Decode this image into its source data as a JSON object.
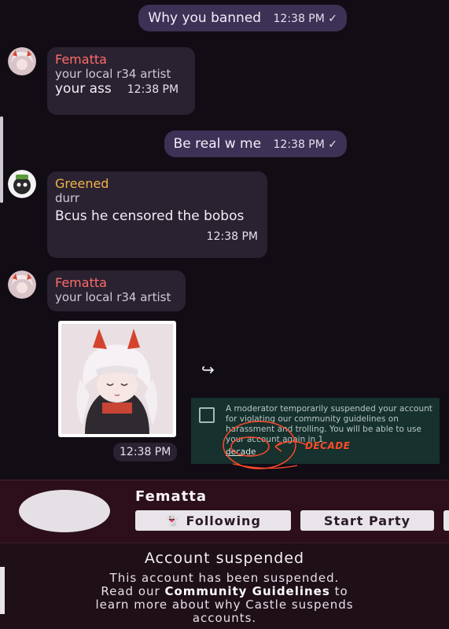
{
  "messages": [
    {
      "type": "out",
      "text": "Why you banned",
      "time": "12:38 PM ✓"
    },
    {
      "type": "in",
      "sender": "Fematta",
      "sender_color": "#ff6b6b",
      "subtitle": "your local r34 artist",
      "text": "your ass",
      "time": "12:38 PM"
    },
    {
      "type": "out",
      "text": "Be real w me",
      "time": "12:38 PM ✓"
    },
    {
      "type": "in",
      "sender": "Greened",
      "sender_color": "#f0b34a",
      "subtitle": "durr",
      "text": "Bcus he censored the bobos",
      "time": "12:38 PM"
    },
    {
      "type": "in-image",
      "sender": "Fematta",
      "sender_color": "#ff6b6b",
      "subtitle": "your local r34 artist",
      "time": "12:38 PM"
    }
  ],
  "forward_icon": "↪",
  "notice": {
    "text": "A moderator temporarily suspended your account for violating our community guidelines on harassment and trolling. You will be able to use your account again in 1",
    "highlight": "decade",
    "annotation": "DECADE"
  },
  "profile": {
    "name": "Fematta",
    "following_label": "Following",
    "party_label": "Start Party"
  },
  "suspended": {
    "title": "Account suspended",
    "line1": "This account has been suspended.",
    "line2_pre": "Read our ",
    "line2_link": "Community Guidelines",
    "line2_post": " to",
    "line3": "learn more about why Castle suspends",
    "line4": "accounts."
  },
  "colors": {
    "out_bubble": "#3d3156",
    "in_bubble": "#2a2230",
    "profile_bg": "#2c0f1a",
    "notice_bg": "#16312e"
  }
}
